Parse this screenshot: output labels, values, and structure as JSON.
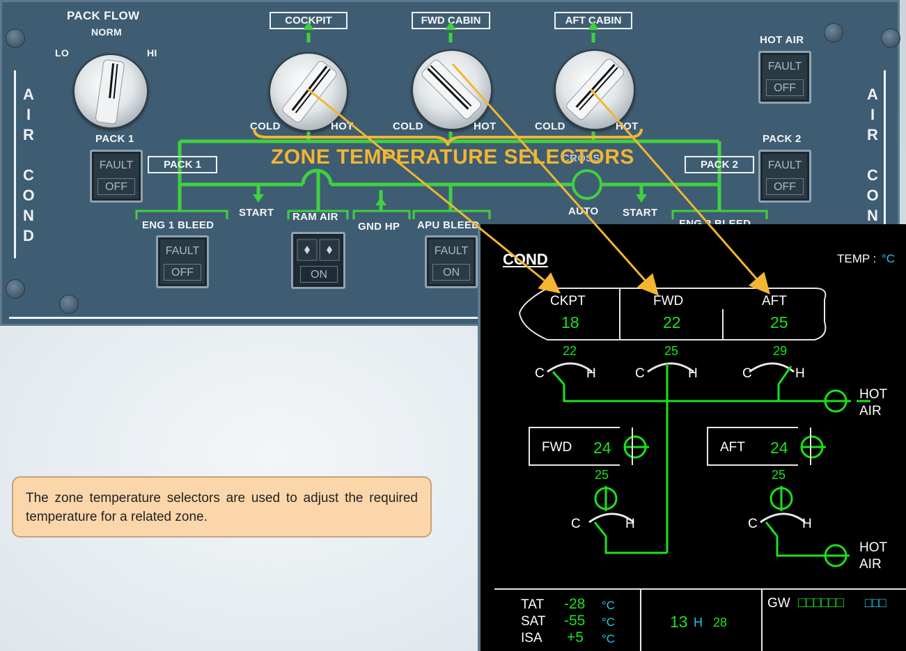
{
  "overhead_panel": {
    "pack_flow": {
      "title": "PACK FLOW",
      "norm": "NORM",
      "lo": "LO",
      "hi": "HI"
    },
    "zone_selectors": [
      {
        "label": "COCKPIT",
        "cold": "COLD",
        "hot": "HOT"
      },
      {
        "label": "FWD CABIN",
        "cold": "COLD",
        "hot": "HOT"
      },
      {
        "label": "AFT CABIN",
        "cold": "COLD",
        "hot": "HOT"
      }
    ],
    "zone_title": "ZONE TEMPERATURE SELECTORS",
    "side_label": "AIR COND",
    "side_label_right": "AIR CON",
    "hot_air": {
      "label": "HOT AIR",
      "fault": "FAULT",
      "state": "OFF"
    },
    "pack1": {
      "label": "PACK 1",
      "fault": "FAULT",
      "state": "OFF",
      "box": "PACK 1"
    },
    "pack2": {
      "label": "PACK 2",
      "fault": "FAULT",
      "state": "OFF",
      "box": "PACK 2"
    },
    "eng1_bleed": {
      "label": "ENG 1 BLEED",
      "fault": "FAULT",
      "state": "OFF"
    },
    "eng2_bleed": {
      "label": "ENG 2 BLEED"
    },
    "ram_air": {
      "label": "RAM AIR",
      "state": "ON"
    },
    "gnd_hp": "GND HP",
    "apu_bleed": {
      "label": "APU BLEED",
      "fault": "FAULT",
      "state": "ON"
    },
    "start_left": "START",
    "start_right": "START",
    "auto": "AUTO",
    "partial_label": "CROSS"
  },
  "caption": "The zone temperature selectors are used to adjust the required temperature for a related zone.",
  "ecam": {
    "title": "COND",
    "temp_label": "TEMP :",
    "temp_unit": "°C",
    "zones": [
      {
        "name": "CKPT",
        "temp": "18",
        "duct": "22"
      },
      {
        "name": "FWD",
        "temp": "22",
        "duct": "25"
      },
      {
        "name": "AFT",
        "temp": "25",
        "duct": "29"
      }
    ],
    "valve_c": "C",
    "valve_h": "H",
    "hot_air_1": "HOT",
    "hot_air_2": "AIR",
    "cargo": [
      {
        "name": "FWD",
        "temp": "24",
        "duct": "25"
      },
      {
        "name": "AFT",
        "temp": "24",
        "duct": "25"
      }
    ],
    "lower": {
      "tat_label": "TAT",
      "tat": "-28",
      "sat_label": "SAT",
      "sat": "-55",
      "isa_label": "ISA",
      "isa": "+5",
      "unit": "°C",
      "clock_h": "13",
      "clock_sep": "H",
      "clock_m": "28",
      "gw_label": "GW",
      "gw_value": "□□□□□□",
      "gw_unit": "□□□"
    }
  },
  "colors": {
    "panel": "#3f5d72",
    "ecam_green": "#19e319",
    "ecam_cyan": "#28c6e8",
    "annotation": "#f2b632",
    "caption_bg": "#fbd6ab"
  }
}
